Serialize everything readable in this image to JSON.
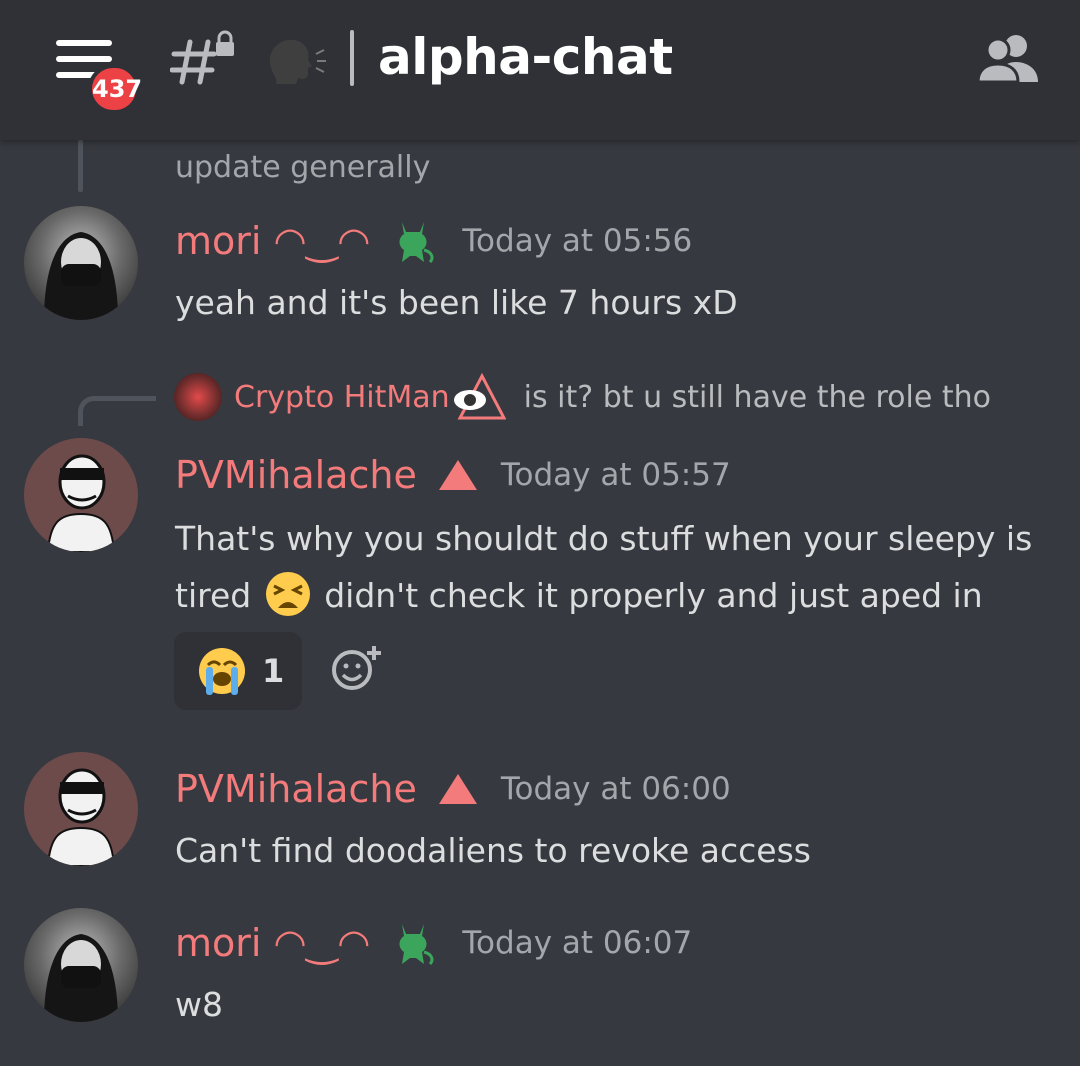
{
  "header": {
    "menu_badge": "437",
    "channel_emoji": "speaking-head",
    "channel_name": "alpha-chat"
  },
  "partial_message": {
    "text": "update generally"
  },
  "messages": [
    {
      "username": "mori ◠‿◠",
      "role_icon": "green-devil",
      "timestamp": "Today at 05:56",
      "text": "yeah and it's been like 7 hours xD"
    },
    {
      "reply": {
        "username": "Crypto HitMan",
        "text": "is it? bt u still have the role tho"
      },
      "username": "PVMihalache",
      "role_icon": "red-triangle",
      "timestamp": "Today at 05:57",
      "text_part1": "That's why you shouldt do stuff when your sleepy is tired",
      "text_part2": "didn't check it properly and just aped in",
      "reaction": {
        "emoji": "loudly-crying-face",
        "count": "1"
      }
    },
    {
      "username": "PVMihalache",
      "role_icon": "red-triangle",
      "timestamp": "Today at 06:00",
      "text": "Can't find doodaliens to revoke access"
    },
    {
      "username": "mori ◠‿◠",
      "role_icon": "green-devil",
      "timestamp": "Today at 06:07",
      "text": "w8"
    }
  ],
  "colors": {
    "background": "#36393f",
    "header": "#2f3136",
    "username": "#f47b7b",
    "badge": "#ed4245"
  }
}
